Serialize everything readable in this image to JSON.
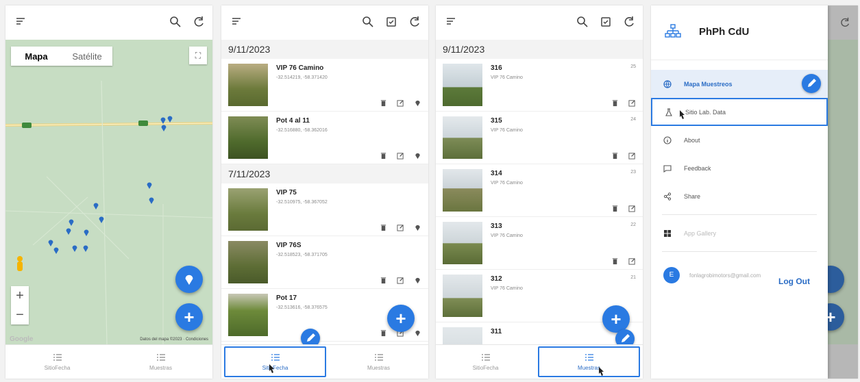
{
  "colors": {
    "accent": "#2a7ae2",
    "map_bg": "#c7ddc3",
    "road": "#e9d58b"
  },
  "screen1": {
    "map_type": {
      "map_label": "Mapa",
      "satellite_label": "Satélite"
    },
    "footer": {
      "google": "Google",
      "credits": "Datos del mapa ©2023 · Condiciones"
    },
    "fab_location_icon": "location-icon",
    "fab_add_label": "+",
    "zoom_in": "+",
    "zoom_out": "−"
  },
  "nav": {
    "sitio_fecha": "SitioFecha",
    "muestras": "Muestras"
  },
  "screen2": {
    "groups": [
      {
        "date": "9/11/2023",
        "items": [
          {
            "title": "VIP 76 Camino",
            "coords": "-32.514219, -58.371420"
          },
          {
            "title": "Pot 4 al 11",
            "coords": "-32.516880, -58.362016"
          }
        ]
      },
      {
        "date": "7/11/2023",
        "items": [
          {
            "title": "VIP 75",
            "coords": "-32.510975, -58.367052"
          },
          {
            "title": "VIP 76S",
            "coords": "-32.518523, -58.371705"
          },
          {
            "title": "Pot 17",
            "coords": "-32.513616, -58.376575"
          }
        ]
      }
    ],
    "fab_add_label": "+"
  },
  "screen3": {
    "date": "9/11/2023",
    "items": [
      {
        "title": "316",
        "subtitle": "VIP 76 Camino",
        "num": "25"
      },
      {
        "title": "315",
        "subtitle": "VIP 76 Camino",
        "num": "24"
      },
      {
        "title": "314",
        "subtitle": "VIP 76 Camino",
        "num": "23"
      },
      {
        "title": "313",
        "subtitle": "VIP 76 Camino",
        "num": "22"
      },
      {
        "title": "312",
        "subtitle": "VIP 76 Camino",
        "num": "21"
      },
      {
        "title": "311",
        "subtitle": "",
        "num": ""
      }
    ],
    "fab_add_label": "+"
  },
  "screen4": {
    "drawer_title": "PhPh CdU",
    "items": [
      {
        "label": "Mapa Muestreos",
        "icon": "globe-icon"
      },
      {
        "label": "Sitio Lab. Data",
        "icon": "flask-icon"
      },
      {
        "label": "About",
        "icon": "info-icon"
      },
      {
        "label": "Feedback",
        "icon": "feedback-icon"
      },
      {
        "label": "Share",
        "icon": "share-icon"
      },
      {
        "label": "App Gallery",
        "icon": "gallery-icon"
      }
    ],
    "user": {
      "initial": "E",
      "email": "fonlagrobimotors@gmail.com"
    },
    "logout": "Log Out",
    "fab_add_label": "+"
  }
}
